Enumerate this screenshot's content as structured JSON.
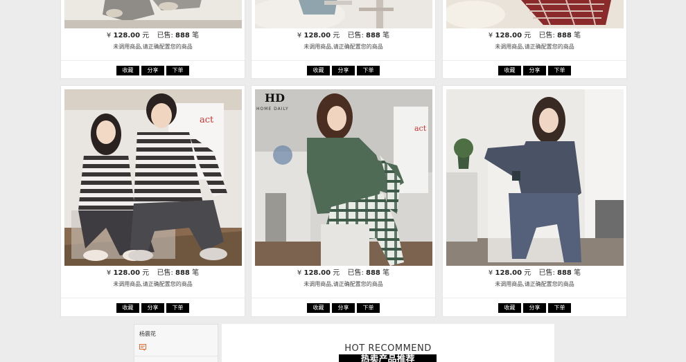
{
  "products_row1": [
    {
      "currency": "¥",
      "price": "128.00",
      "unit": "元",
      "sold_label": "已售:",
      "sold": "888",
      "sold_unit": "笔",
      "note": "未调用商品,请正确配置您的商品",
      "buttons": [
        "收藏",
        "分享",
        "下单"
      ]
    },
    {
      "currency": "¥",
      "price": "128.00",
      "unit": "元",
      "sold_label": "已售:",
      "sold": "888",
      "sold_unit": "笔",
      "note": "未调用商品,请正确配置您的商品",
      "buttons": [
        "收藏",
        "分享",
        "下单"
      ]
    },
    {
      "currency": "¥",
      "price": "128.00",
      "unit": "元",
      "sold_label": "已售:",
      "sold": "888",
      "sold_unit": "笔",
      "note": "未调用商品,请正确配置您的商品",
      "buttons": [
        "收藏",
        "分享",
        "下单"
      ]
    }
  ],
  "products_row2": [
    {
      "currency": "¥",
      "price": "128.00",
      "unit": "元",
      "sold_label": "已售:",
      "sold": "888",
      "sold_unit": "笔",
      "note": "未调用商品,请正确配置您的商品",
      "buttons": [
        "收藏",
        "分享",
        "下单"
      ]
    },
    {
      "currency": "¥",
      "price": "128.00",
      "unit": "元",
      "sold_label": "已售:",
      "sold": "888",
      "sold_unit": "笔",
      "note": "未调用商品,请正确配置您的商品",
      "buttons": [
        "收藏",
        "分享",
        "下单"
      ],
      "photo_brand_top": "HD",
      "photo_brand": "HOME DAILY",
      "photo_wall_text": "act ific ial"
    },
    {
      "currency": "¥",
      "price": "128.00",
      "unit": "元",
      "sold_label": "已售:",
      "sold": "888",
      "sold_unit": "笔",
      "note": "未调用商品,请正确配置您的商品",
      "buttons": [
        "收藏",
        "分享",
        "下单"
      ]
    }
  ],
  "photo1_wall_text": "act ific ial",
  "sidebar": {
    "shop_name": "杨震花"
  },
  "recommend": {
    "title_en": "HOT RECOMMEND",
    "title_cn": "热卖产品推荐"
  },
  "colors": {
    "button_bg": "#000000",
    "page_bg": "#ececec"
  }
}
